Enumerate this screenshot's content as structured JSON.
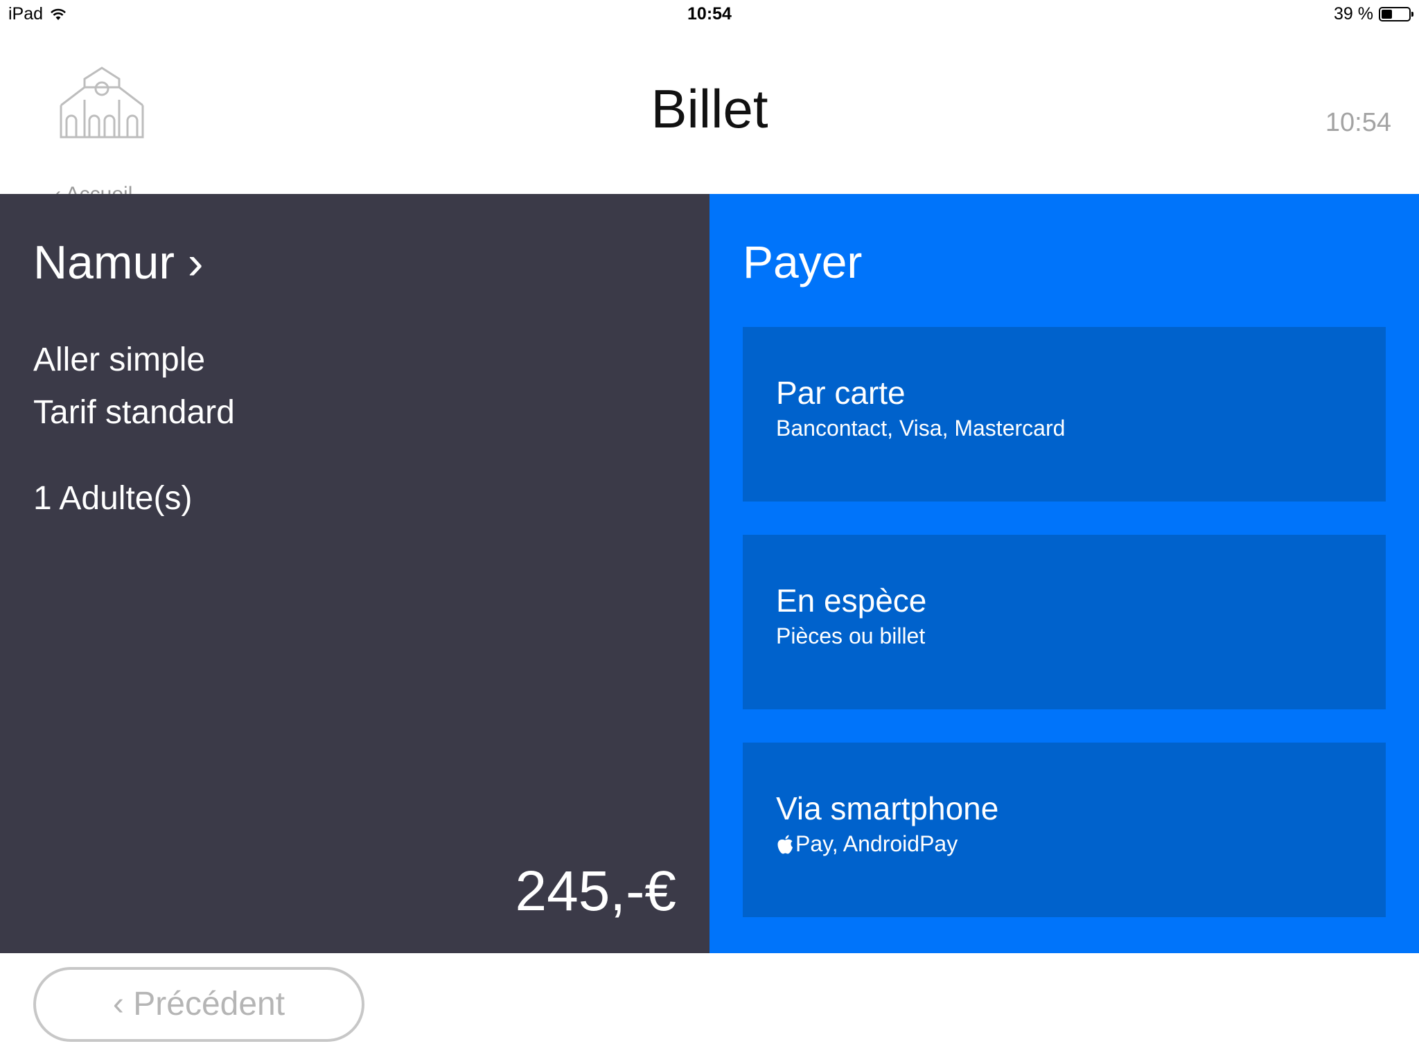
{
  "status_bar": {
    "device": "iPad",
    "time": "10:54",
    "battery": "39 %",
    "battery_level": 0.39
  },
  "header": {
    "home_label": "‹ Accueil",
    "title": "Billet",
    "time": "10:54"
  },
  "ticket": {
    "destination": "Namur ›",
    "trip_type": "Aller simple",
    "fare_type": "Tarif standard",
    "passengers": "1 Adulte(s)",
    "price": "245,-€"
  },
  "payment": {
    "title": "Payer",
    "options": [
      {
        "title": "Par carte",
        "subtitle": "Bancontact, Visa, Mastercard"
      },
      {
        "title": "En espèce",
        "subtitle": "Pièces ou billet"
      },
      {
        "title": "Via smartphone",
        "subtitle": "Pay, AndroidPay"
      }
    ]
  },
  "footer": {
    "back_label": "‹ Précédent"
  },
  "colors": {
    "left_panel": "#3b3a48",
    "right_panel": "#0074fa",
    "option_tile": "#0062cc"
  },
  "icons": {
    "home": "church-icon",
    "wifi": "wifi-icon",
    "battery": "battery-icon",
    "apple": "apple-icon"
  }
}
